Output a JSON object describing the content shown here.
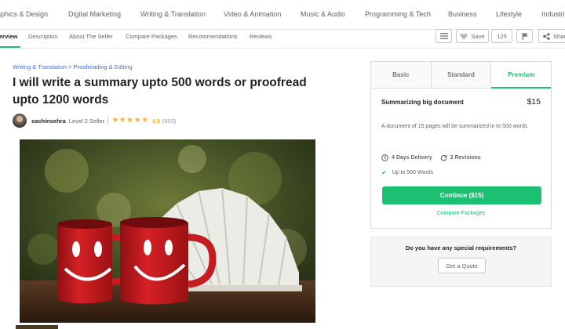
{
  "categories": [
    "aphics & Design",
    "Digital Marketing",
    "Writing & Translation",
    "Video & Animation",
    "Music & Audio",
    "Programming & Tech",
    "Business",
    "Lifestyle",
    "Industri"
  ],
  "subnav": {
    "items": [
      "erview",
      "Description",
      "About The Seller",
      "Compare Packages",
      "Recommendations",
      "Reviews"
    ],
    "save_label": "Save",
    "likes_count": "125",
    "share_label": "Share"
  },
  "breadcrumb": {
    "level1": "Writing & Translation",
    "separator": ">",
    "level2": "Proofreading & Editing"
  },
  "gig": {
    "title": "I will write a summary upto 500 words or proofread upto 1200 words"
  },
  "seller": {
    "username": "sachinsehra",
    "level": "Level 2 Seller",
    "rating": "4.9",
    "reviews": "(653)",
    "stars": 5
  },
  "package": {
    "tabs": [
      "Basic",
      "Standard",
      "Premium"
    ],
    "active_tab": "Premium",
    "name": "Summarizing big document",
    "price": "$15",
    "description": "A document of 15 pages will be summarized in to 500 words",
    "delivery": "4 Days Delivery",
    "revisions": "2 Revisions",
    "feature": "Up to 500 Words",
    "continue_label": "Continue ($15)",
    "compare_label": "Compare Packages"
  },
  "quote": {
    "question": "Do you have any special requirements?",
    "button_label": "Get a Quote"
  },
  "colors": {
    "accent": "#1dbf73",
    "link": "#446ee7",
    "star": "#ffb33e"
  }
}
